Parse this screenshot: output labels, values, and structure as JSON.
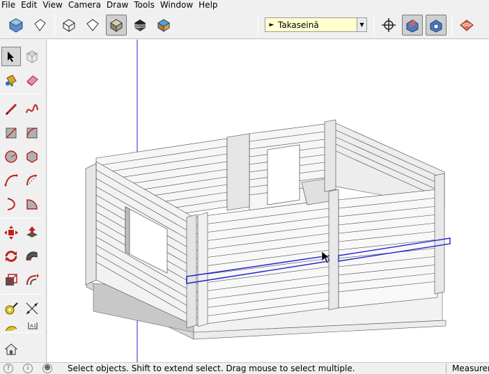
{
  "menu": [
    "File",
    "Edit",
    "View",
    "Camera",
    "Draw",
    "Tools",
    "Window",
    "Help"
  ],
  "layer": {
    "current": "Takaseinä"
  },
  "status": {
    "message": "Select objects. Shift to extend select. Drag mouse to select multiple.",
    "measurements_label": "Measurem"
  },
  "colors": {
    "background": "#f0f0f0",
    "viewport": "#ffffff",
    "layer_combo": "#ffffd0",
    "axis_blue": "#2020d0",
    "wall": "#f4f4f4",
    "wall_shadow": "#cfcfcf"
  },
  "icons": {
    "top_toolbar": [
      "iso-view-icon",
      "wireframe-style-icon",
      "xray-style-icon",
      "hidden-line-style-icon",
      "shaded-style-icon",
      "monochrome-style-icon",
      "textured-style-icon",
      "orbit-icon",
      "section-plane-icon",
      "section-display-icon",
      "sandbox-icon"
    ],
    "left_toolbar": [
      "select-icon",
      "make-component-icon",
      "paint-bucket-icon",
      "eraser-icon",
      "pencil-icon",
      "freehand-icon",
      "rectangle-icon",
      "rotated-rectangle-icon",
      "circle-icon",
      "polygon-icon",
      "arc-icon",
      "two-point-arc-icon",
      "three-point-arc-icon",
      "pie-icon",
      "move-icon",
      "push-pull-icon",
      "rotate-icon",
      "follow-me-icon",
      "scale-icon",
      "offset-icon",
      "tape-measure-icon",
      "dimension-icon",
      "protractor-icon",
      "text-icon",
      "warehouse-icon"
    ]
  }
}
